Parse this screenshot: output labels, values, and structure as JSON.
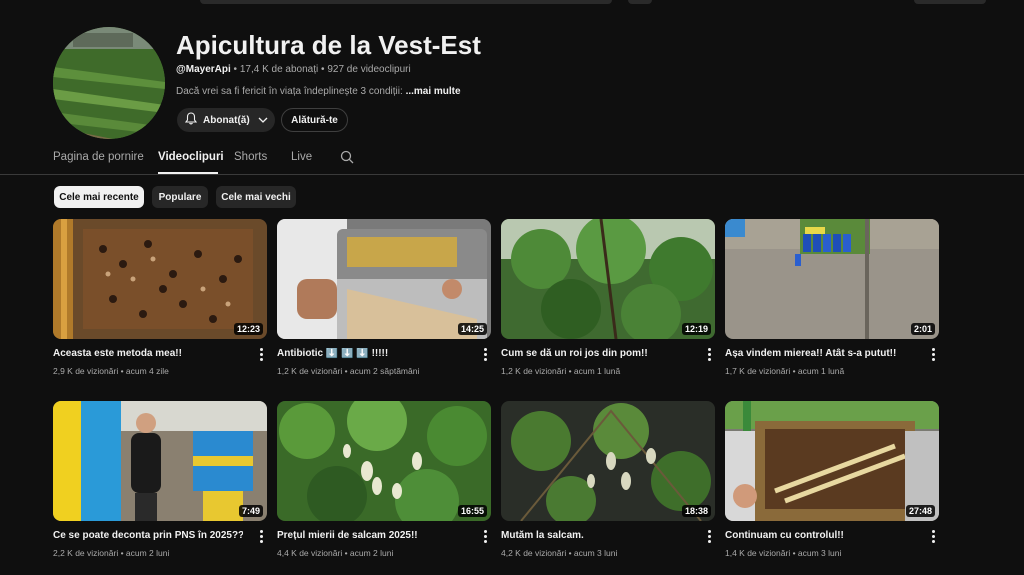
{
  "channel": {
    "name": "Apicultura de la Vest-Est",
    "handle": "@MayerApi",
    "subscribers": "17,4 K de abonați",
    "video_count": "927 de videoclipuri",
    "separator": "•",
    "description": "Dacă vrei sa fi fericit în viața îndeplinește 3 condiții:",
    "more_label": "...mai multe",
    "subscribe_label": "Abonat(ă)",
    "join_label": "Alătură-te"
  },
  "tabs": [
    {
      "label": "Pagina de pornire"
    },
    {
      "label": "Videoclipuri",
      "active": true
    },
    {
      "label": "Shorts"
    },
    {
      "label": "Live"
    }
  ],
  "chips": [
    {
      "label": "Cele mai recente",
      "active": true
    },
    {
      "label": "Populare"
    },
    {
      "label": "Cele mai vechi"
    }
  ],
  "videos": [
    {
      "title": "Aceasta este metoda mea!!",
      "views": "2,9 K de vizionări",
      "age": "acum 4 zile",
      "duration": "12:23"
    },
    {
      "title": "Antibiotic ⬇️ ⬇️ ⬇️ !!!!!",
      "views": "1,2 K de vizionări",
      "age": "acum 2 săptămâni",
      "duration": "14:25"
    },
    {
      "title": "Cum se dă un roi jos din pom!!",
      "views": "1,2 K de vizionări",
      "age": "acum 1 lună",
      "duration": "12:19"
    },
    {
      "title": "Așa vindem mierea!! Atât s-a putut!!",
      "views": "1,7 K de vizionări",
      "age": "acum 1 lună",
      "duration": "2:01"
    },
    {
      "title": "Ce se poate deconta prin PNS în 2025??",
      "views": "2,2 K de vizionări",
      "age": "acum 2 luni",
      "duration": "7:49"
    },
    {
      "title": "Prețul mierii de salcam 2025!!",
      "views": "4,4 K de vizionări",
      "age": "acum 2 luni",
      "duration": "16:55"
    },
    {
      "title": "Mutăm la salcam.",
      "views": "4,2 K de vizionări",
      "age": "acum 3 luni",
      "duration": "18:38"
    },
    {
      "title": "Continuam cu controlul!!",
      "views": "1,4 K de vizionări",
      "age": "acum 3 luni",
      "duration": "27:48"
    }
  ],
  "icons": {
    "bell": "bell-icon",
    "chevron": "chevron-down-icon",
    "search": "search-icon",
    "kebab": "more-vert-icon"
  },
  "colors": {
    "background": "#0f0f0f",
    "text": "#f1f1f1",
    "muted": "#aaaaaa",
    "chip_bg": "#272727"
  }
}
